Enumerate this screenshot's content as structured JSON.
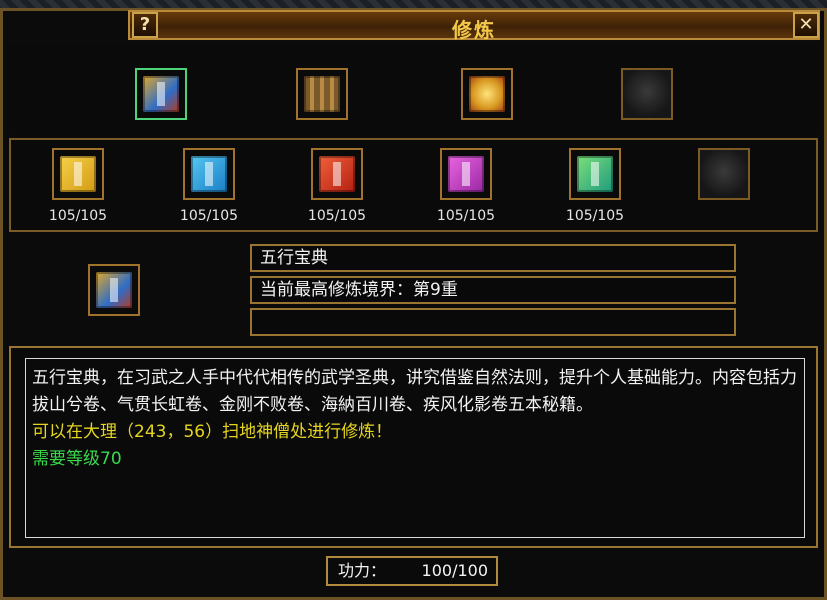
{
  "window": {
    "title": "修炼",
    "help_label": "?",
    "close_label": "✕"
  },
  "top_slots": [
    {
      "icon": "book-icon",
      "color": "#2f6cc7",
      "selected": true
    },
    {
      "icon": "scroll-bundle-icon",
      "color": "#7a5a2a",
      "selected": false
    },
    {
      "icon": "golden-scrolls-icon",
      "color": "#d89a22",
      "selected": false
    },
    {
      "icon": "empty-slot",
      "color": "#2a2a2a",
      "selected": false
    }
  ],
  "books": [
    {
      "icon": "yellow-book-icon",
      "color": "#e7b628",
      "count": "105/105"
    },
    {
      "icon": "blue-book-icon",
      "color": "#1f9bd7",
      "count": "105/105"
    },
    {
      "icon": "red-book-icon",
      "color": "#d23a22",
      "count": "105/105"
    },
    {
      "icon": "purple-book-icon",
      "color": "#c43fbe",
      "count": "105/105"
    },
    {
      "icon": "green-book-icon",
      "color": "#35b96a",
      "count": "105/105"
    },
    {
      "icon": "empty-slot",
      "color": "#2a2a2a",
      "count": ""
    }
  ],
  "selected": {
    "icon": "book-icon",
    "name": "五行宝典",
    "realm": "当前最高修炼境界：第9重",
    "extra": ""
  },
  "description": {
    "text": "五行宝典，在习武之人手中代代相传的武学圣典，讲究借鉴自然法则，提升个人基础能力。内容包括力拔山兮卷、气贯长虹卷、金刚不败卷、海納百川卷、疾风化影卷五本秘籍。",
    "location": "可以在大理（243，56）扫地神僧处进行修炼！",
    "level": "需要等级70"
  },
  "power": {
    "label": "功力：",
    "value": "100/100"
  }
}
